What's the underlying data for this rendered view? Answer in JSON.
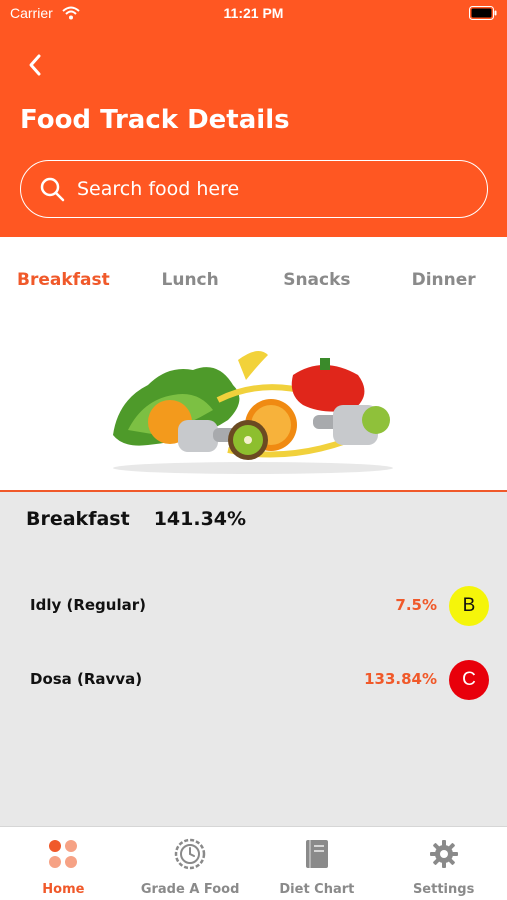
{
  "status_bar": {
    "carrier": "Carrier",
    "time": "11:21 PM"
  },
  "header": {
    "title": "Food Track Details",
    "back_icon": "chevron-left-icon"
  },
  "search": {
    "placeholder": "Search food here",
    "value": "",
    "icon": "search-icon"
  },
  "meal_tabs": [
    {
      "label": "Breakfast",
      "active": true
    },
    {
      "label": "Lunch",
      "active": false
    },
    {
      "label": "Snacks",
      "active": false
    },
    {
      "label": "Dinner",
      "active": false
    }
  ],
  "summary": {
    "meal": "Breakfast",
    "percent": "141.34%"
  },
  "foods": [
    {
      "name": "Idly (Regular)",
      "percent": "7.5%",
      "grade": "B",
      "grade_color": "#f5f50a"
    },
    {
      "name": "Dosa (Ravva)",
      "percent": "133.84%",
      "grade": "C",
      "grade_color": "#e8000b"
    }
  ],
  "bottom_nav": [
    {
      "label": "Home",
      "icon": "home-dots-icon",
      "active": true
    },
    {
      "label": "Grade A Food",
      "icon": "clock-icon",
      "active": false
    },
    {
      "label": "Diet Chart",
      "icon": "book-icon",
      "active": false
    },
    {
      "label": "Settings",
      "icon": "gear-icon",
      "active": false
    }
  ],
  "colors": {
    "accent": "#ff5722",
    "accent_text": "#f0592a",
    "content_bg": "#e8e8e8"
  }
}
